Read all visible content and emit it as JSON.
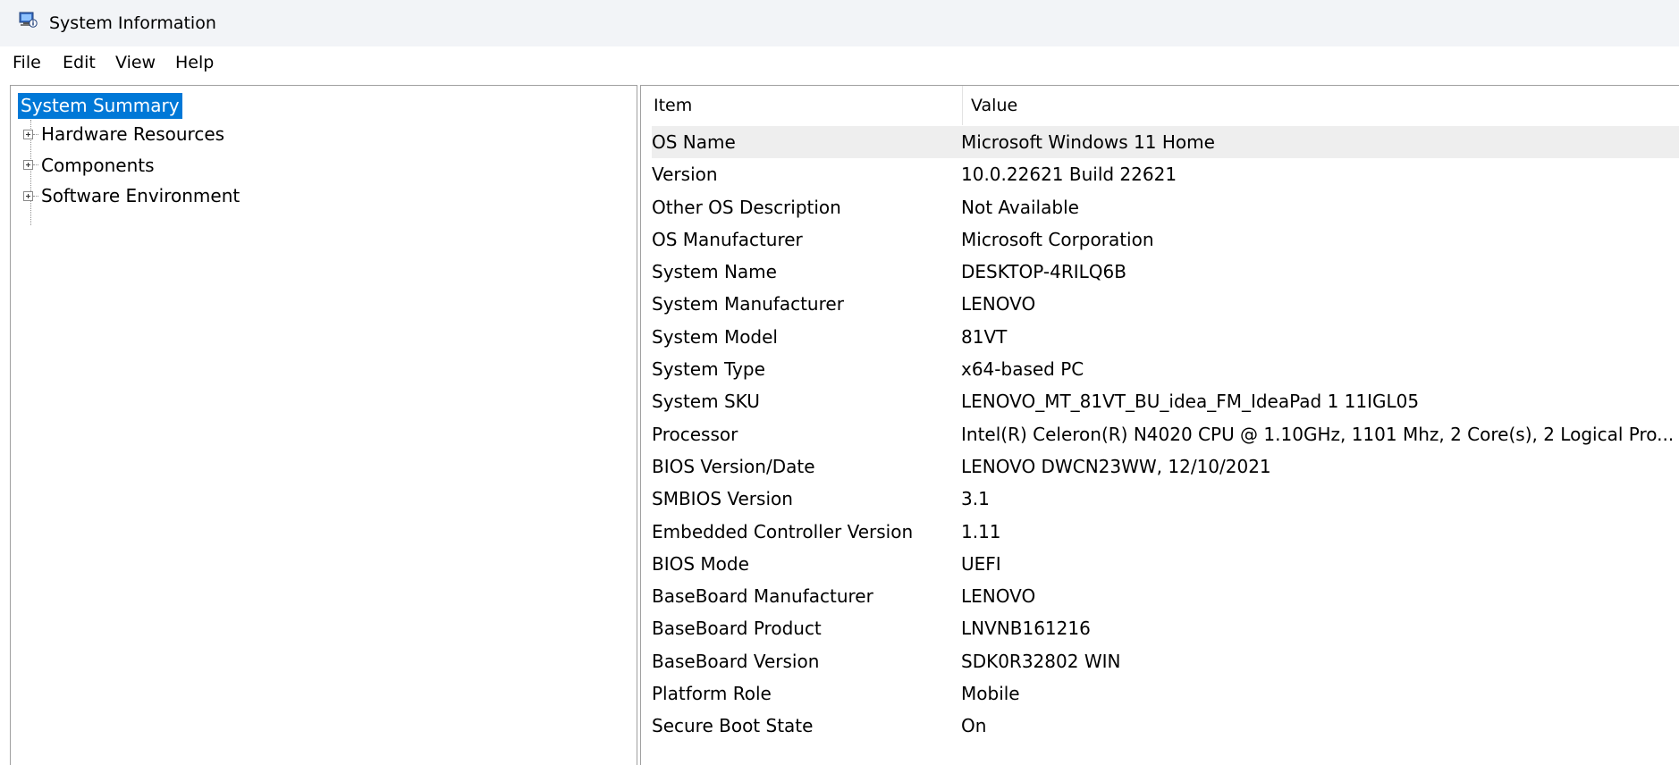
{
  "window": {
    "title": "System Information",
    "icon": "system-information-icon"
  },
  "menu": {
    "items": [
      "File",
      "Edit",
      "View",
      "Help"
    ]
  },
  "tree": {
    "selected": "System Summary",
    "children": [
      "Hardware Resources",
      "Components",
      "Software Environment"
    ]
  },
  "table": {
    "headers": {
      "item": "Item",
      "value": "Value"
    },
    "rows": [
      {
        "item": "OS Name",
        "value": "Microsoft Windows 11 Home"
      },
      {
        "item": "Version",
        "value": "10.0.22621 Build 22621"
      },
      {
        "item": "Other OS Description",
        "value": "Not Available"
      },
      {
        "item": "OS Manufacturer",
        "value": "Microsoft Corporation"
      },
      {
        "item": "System Name",
        "value": "DESKTOP-4RILQ6B"
      },
      {
        "item": "System Manufacturer",
        "value": "LENOVO"
      },
      {
        "item": "System Model",
        "value": "81VT"
      },
      {
        "item": "System Type",
        "value": "x64-based PC"
      },
      {
        "item": "System SKU",
        "value": "LENOVO_MT_81VT_BU_idea_FM_IdeaPad 1 11IGL05"
      },
      {
        "item": "Processor",
        "value": "Intel(R) Celeron(R) N4020 CPU @ 1.10GHz, 1101 Mhz, 2 Core(s), 2 Logical Pro..."
      },
      {
        "item": "BIOS Version/Date",
        "value": "LENOVO DWCN23WW, 12/10/2021"
      },
      {
        "item": "SMBIOS Version",
        "value": "3.1"
      },
      {
        "item": "Embedded Controller Version",
        "value": "1.11"
      },
      {
        "item": "BIOS Mode",
        "value": "UEFI"
      },
      {
        "item": "BaseBoard Manufacturer",
        "value": "LENOVO"
      },
      {
        "item": "BaseBoard Product",
        "value": "LNVNB161216"
      },
      {
        "item": "BaseBoard Version",
        "value": "SDK0R32802 WIN"
      },
      {
        "item": "Platform Role",
        "value": "Mobile"
      },
      {
        "item": "Secure Boot State",
        "value": "On"
      }
    ]
  },
  "colors": {
    "selection": "#0078d7",
    "titlebar": "#f2f4f7",
    "row_highlight": "#eeeeee"
  }
}
